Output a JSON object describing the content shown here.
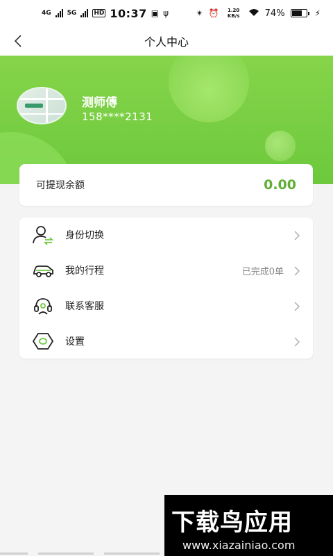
{
  "status_bar": {
    "net_left": "4G",
    "net_right": "5G",
    "hd": "HD",
    "time": "10:37",
    "speed": "1.20 KB/s",
    "battery": "74%",
    "battery_level": 0.74
  },
  "header": {
    "title": "个人中心"
  },
  "profile": {
    "name": "测师傅",
    "phone": "158****2131"
  },
  "balance": {
    "label": "可提现余额",
    "value": "0.00"
  },
  "menu": [
    {
      "label": "身份切换",
      "icon": "user-switch-icon",
      "extra": ""
    },
    {
      "label": "我的行程",
      "icon": "car-icon",
      "extra": "已完成0单"
    },
    {
      "label": "联系客服",
      "icon": "headset-icon",
      "extra": ""
    },
    {
      "label": "设置",
      "icon": "settings-hexagon-icon",
      "extra": ""
    }
  ],
  "watermark": {
    "title": "下载鸟应用",
    "url": "www.xiazainiao.com"
  },
  "colors": {
    "brand_green": "#6dc93c",
    "balance_green": "#5fae36"
  }
}
